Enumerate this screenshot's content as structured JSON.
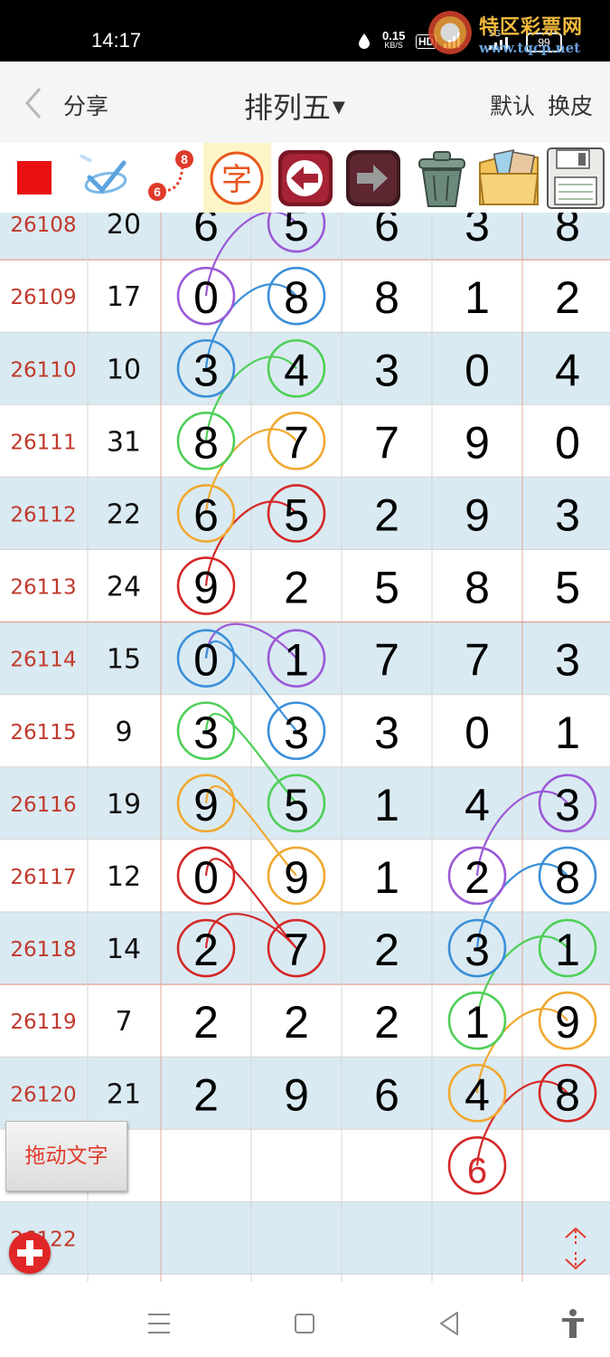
{
  "status_bar": {
    "time": "14:17",
    "net_speed": "0.15",
    "net_unit": "KB/S",
    "hd_label": "HD",
    "signal_5g": "5G",
    "battery": "99"
  },
  "watermark": {
    "name": "特区彩票网",
    "url": "www.tqcp.net"
  },
  "header": {
    "share_label": "分享",
    "title": "排列五",
    "default_label": "默认",
    "skin_label": "换皮"
  },
  "toolbar": {
    "tools": [
      "red-square-tool",
      "check-pen-tool",
      "connect-numbers-tool",
      "text-tool",
      "undo-tool",
      "redo-tool",
      "trash-tool",
      "gallery-tool",
      "save-tool"
    ],
    "text_tool_glyph": "字",
    "connect_num_a": "6",
    "connect_num_b": "8"
  },
  "table": {
    "issue_color": "#c0392b",
    "rows": [
      {
        "issue": "26108",
        "sum": "20",
        "digits": [
          "6",
          "5",
          "6",
          "3",
          "8"
        ]
      },
      {
        "issue": "26109",
        "sum": "17",
        "digits": [
          "0",
          "8",
          "8",
          "1",
          "2"
        ]
      },
      {
        "issue": "26110",
        "sum": "10",
        "digits": [
          "3",
          "4",
          "3",
          "0",
          "4"
        ]
      },
      {
        "issue": "26111",
        "sum": "31",
        "digits": [
          "8",
          "7",
          "7",
          "9",
          "0"
        ]
      },
      {
        "issue": "26112",
        "sum": "22",
        "digits": [
          "6",
          "5",
          "2",
          "9",
          "3"
        ]
      },
      {
        "issue": "26113",
        "sum": "24",
        "digits": [
          "9",
          "2",
          "5",
          "8",
          "5"
        ]
      },
      {
        "issue": "26114",
        "sum": "15",
        "digits": [
          "0",
          "1",
          "7",
          "7",
          "3"
        ]
      },
      {
        "issue": "26115",
        "sum": "9",
        "digits": [
          "3",
          "3",
          "3",
          "0",
          "1"
        ]
      },
      {
        "issue": "26116",
        "sum": "19",
        "digits": [
          "9",
          "5",
          "1",
          "4",
          "3"
        ]
      },
      {
        "issue": "26117",
        "sum": "12",
        "digits": [
          "0",
          "9",
          "1",
          "2",
          "8"
        ]
      },
      {
        "issue": "26118",
        "sum": "14",
        "digits": [
          "2",
          "7",
          "2",
          "3",
          "1"
        ]
      },
      {
        "issue": "26119",
        "sum": "7",
        "digits": [
          "2",
          "2",
          "2",
          "1",
          "9"
        ]
      },
      {
        "issue": "26120",
        "sum": "21",
        "digits": [
          "2",
          "9",
          "6",
          "4",
          "8"
        ]
      },
      {
        "issue": "",
        "sum": "",
        "digits": [
          "",
          "",
          "",
          "6",
          ""
        ]
      },
      {
        "issue": "26122",
        "sum": "",
        "digits": [
          "",
          "",
          "",
          "",
          ""
        ]
      }
    ],
    "circles": [
      {
        "row": 0,
        "col": 1,
        "color": "#9b59d6"
      },
      {
        "row": 1,
        "col": 0,
        "color": "#9b59d6"
      },
      {
        "row": 1,
        "col": 1,
        "color": "#3b8fd9"
      },
      {
        "row": 2,
        "col": 0,
        "color": "#3b8fd9"
      },
      {
        "row": 2,
        "col": 1,
        "color": "#4fcf58"
      },
      {
        "row": 3,
        "col": 0,
        "color": "#4fcf58"
      },
      {
        "row": 3,
        "col": 1,
        "color": "#f0a830"
      },
      {
        "row": 4,
        "col": 0,
        "color": "#f0a830"
      },
      {
        "row": 4,
        "col": 1,
        "color": "#d42828"
      },
      {
        "row": 5,
        "col": 0,
        "color": "#d42828"
      },
      {
        "row": 6,
        "col": 0,
        "color": "#3b8fd9"
      },
      {
        "row": 6,
        "col": 1,
        "color": "#9b59d6"
      },
      {
        "row": 7,
        "col": 0,
        "color": "#4fcf58"
      },
      {
        "row": 7,
        "col": 1,
        "color": "#3b8fd9"
      },
      {
        "row": 8,
        "col": 0,
        "color": "#f0a830"
      },
      {
        "row": 8,
        "col": 1,
        "color": "#4fcf58"
      },
      {
        "row": 8,
        "col": 4,
        "color": "#9b59d6"
      },
      {
        "row": 9,
        "col": 0,
        "color": "#d42828"
      },
      {
        "row": 9,
        "col": 1,
        "color": "#f0a830"
      },
      {
        "row": 9,
        "col": 3,
        "color": "#9b59d6"
      },
      {
        "row": 9,
        "col": 4,
        "color": "#3b8fd9"
      },
      {
        "row": 10,
        "col": 0,
        "color": "#d42828"
      },
      {
        "row": 10,
        "col": 1,
        "color": "#d42828"
      },
      {
        "row": 10,
        "col": 3,
        "color": "#3b8fd9"
      },
      {
        "row": 10,
        "col": 4,
        "color": "#4fcf58"
      },
      {
        "row": 11,
        "col": 3,
        "color": "#4fcf58"
      },
      {
        "row": 11,
        "col": 4,
        "color": "#f0a830"
      },
      {
        "row": 12,
        "col": 3,
        "color": "#f0a830"
      },
      {
        "row": 12,
        "col": 4,
        "color": "#d42828"
      },
      {
        "row": 13,
        "col": 3,
        "color": "#d42828"
      }
    ],
    "arcs": [
      {
        "from": [
          1,
          0
        ],
        "to": [
          0,
          1
        ],
        "color": "#9b59d6"
      },
      {
        "from": [
          2,
          0
        ],
        "to": [
          1,
          1
        ],
        "color": "#3b8fd9"
      },
      {
        "from": [
          3,
          0
        ],
        "to": [
          2,
          1
        ],
        "color": "#4fcf58"
      },
      {
        "from": [
          4,
          0
        ],
        "to": [
          3,
          1
        ],
        "color": "#f0a830"
      },
      {
        "from": [
          5,
          0
        ],
        "to": [
          4,
          1
        ],
        "color": "#d42828"
      },
      {
        "from": [
          6,
          0
        ],
        "to": [
          6,
          1
        ],
        "color": "#9b59d6"
      },
      {
        "from": [
          6,
          0
        ],
        "to": [
          7,
          1
        ],
        "color": "#3b8fd9"
      },
      {
        "from": [
          7,
          0
        ],
        "to": [
          8,
          1
        ],
        "color": "#4fcf58"
      },
      {
        "from": [
          8,
          0
        ],
        "to": [
          9,
          1
        ],
        "color": "#f0a830"
      },
      {
        "from": [
          9,
          0
        ],
        "to": [
          10,
          1
        ],
        "color": "#d42828"
      },
      {
        "from": [
          10,
          0
        ],
        "to": [
          10,
          1
        ],
        "color": "#d42828"
      },
      {
        "from": [
          9,
          3
        ],
        "to": [
          8,
          4
        ],
        "color": "#9b59d6"
      },
      {
        "from": [
          10,
          3
        ],
        "to": [
          9,
          4
        ],
        "color": "#3b8fd9"
      },
      {
        "from": [
          11,
          3
        ],
        "to": [
          10,
          4
        ],
        "color": "#4fcf58"
      },
      {
        "from": [
          12,
          3
        ],
        "to": [
          11,
          4
        ],
        "color": "#f0a830"
      },
      {
        "from": [
          13,
          3
        ],
        "to": [
          12,
          4
        ],
        "color": "#d42828"
      }
    ]
  },
  "floating": {
    "drag_text_label": "拖动文字"
  }
}
